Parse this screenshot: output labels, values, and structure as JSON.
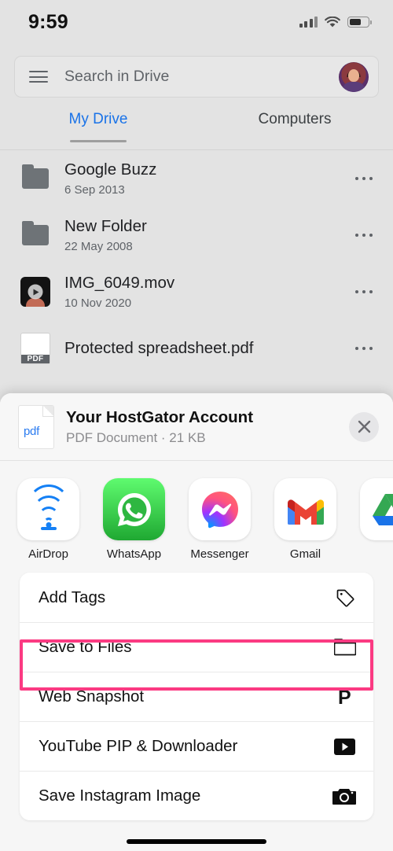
{
  "statusbar": {
    "time": "9:59",
    "signal_icon": "cellular-bars-icon",
    "wifi_icon": "wifi-icon",
    "battery_icon": "battery-icon",
    "battery_level": 62
  },
  "search": {
    "menu_icon": "hamburger-menu-icon",
    "placeholder": "Search in Drive",
    "value": "",
    "avatar_icon": "user-avatar"
  },
  "tabs": [
    {
      "label": "My Drive",
      "active": true
    },
    {
      "label": "Computers",
      "active": false
    }
  ],
  "files": [
    {
      "name": "Google Buzz",
      "date": "6 Sep 2013",
      "icon": "folder-icon",
      "menu_icon": "more-options-icon"
    },
    {
      "name": "New Folder",
      "date": "22 May 2008",
      "icon": "folder-icon",
      "menu_icon": "more-options-icon"
    },
    {
      "name": "IMG_6049.mov",
      "date": "10 Nov 2020",
      "icon": "video-thumbnail-icon",
      "menu_icon": "more-options-icon"
    },
    {
      "name": "Protected spreadsheet.pdf",
      "date": "",
      "icon": "pdf-thumbnail-icon",
      "menu_icon": "more-options-icon"
    }
  ],
  "share_sheet": {
    "doc": {
      "icon": "pdf-file-icon",
      "icon_label": "pdf",
      "title": "Your HostGator Account",
      "subtitle": "PDF Document · 21 KB"
    },
    "close_label": "close-icon",
    "apps": [
      {
        "name": "AirDrop",
        "icon": "airdrop-icon"
      },
      {
        "name": "WhatsApp",
        "icon": "whatsapp-icon"
      },
      {
        "name": "Messenger",
        "icon": "messenger-icon"
      },
      {
        "name": "Gmail",
        "icon": "gmail-icon"
      },
      {
        "name": "",
        "icon": "google-drive-icon"
      }
    ],
    "actions": [
      {
        "label": "Add Tags",
        "icon": "tag-icon",
        "highlighted": false
      },
      {
        "label": "Save to Files",
        "icon": "folder-icon",
        "highlighted": true
      },
      {
        "label": "Web Snapshot",
        "icon": "p-letter-icon",
        "highlighted": false
      },
      {
        "label": "YouTube PIP & Downloader",
        "icon": "play-button-icon",
        "highlighted": false
      },
      {
        "label": "Save Instagram Image",
        "icon": "camera-icon",
        "highlighted": false
      }
    ]
  },
  "colors": {
    "accent_blue": "#1a73e8",
    "highlight_pink": "#fb3a82",
    "page_bg": "#e3e3e3",
    "sheet_bg": "#f6f6f6",
    "card_bg": "#ffffff"
  },
  "home_indicator": "home-indicator"
}
